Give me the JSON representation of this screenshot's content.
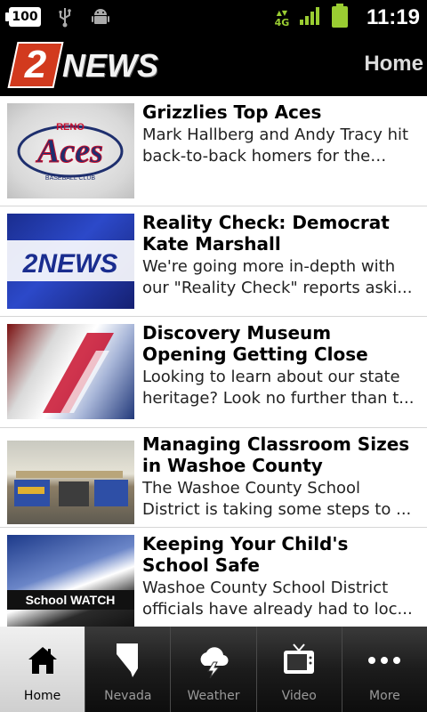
{
  "status_bar": {
    "battery_level": "100",
    "network": "4G",
    "time": "11:19",
    "colors": {
      "signal": "#9acd32",
      "battery": "#9acd32"
    }
  },
  "header": {
    "logo_number": "2",
    "logo_text": "NEWS",
    "title": "Home"
  },
  "articles": [
    {
      "title": "Grizzlies Top Aces",
      "summary": "Mark Hallberg and Andy Tracy hit back-to-back homers for the Aces...",
      "thumb_text": "Aces",
      "thumb_small_top": "RENO",
      "thumb_small_bottom": "BASEBALL CLUB"
    },
    {
      "title": "Reality Check: Democrat Kate Marshall",
      "summary": "We're going more in-depth with our \"Reality Check\" reports aski...",
      "thumb_text": "2NEWS"
    },
    {
      "title": "Discovery Museum Opening Getting Close",
      "summary": "Looking to learn about our state heritage? Look no further than t..."
    },
    {
      "title": "Managing Classroom Sizes in Washoe County",
      "summary": "The Washoe County School District is taking some steps to ..."
    },
    {
      "title": "Keeping Your Child's School Safe",
      "summary": "Washoe County School District officials have already had to loc...",
      "thumb_text": "School WATCH"
    }
  ],
  "tabs": [
    {
      "label": "Home",
      "icon": "home-icon",
      "active": true
    },
    {
      "label": "Nevada",
      "icon": "nevada-icon",
      "active": false
    },
    {
      "label": "Weather",
      "icon": "weather-icon",
      "active": false
    },
    {
      "label": "Video",
      "icon": "video-icon",
      "active": false
    },
    {
      "label": "More",
      "icon": "more-icon",
      "active": false
    }
  ],
  "colors": {
    "brand_red": "#d23a1e",
    "header_bg": "#000000"
  }
}
